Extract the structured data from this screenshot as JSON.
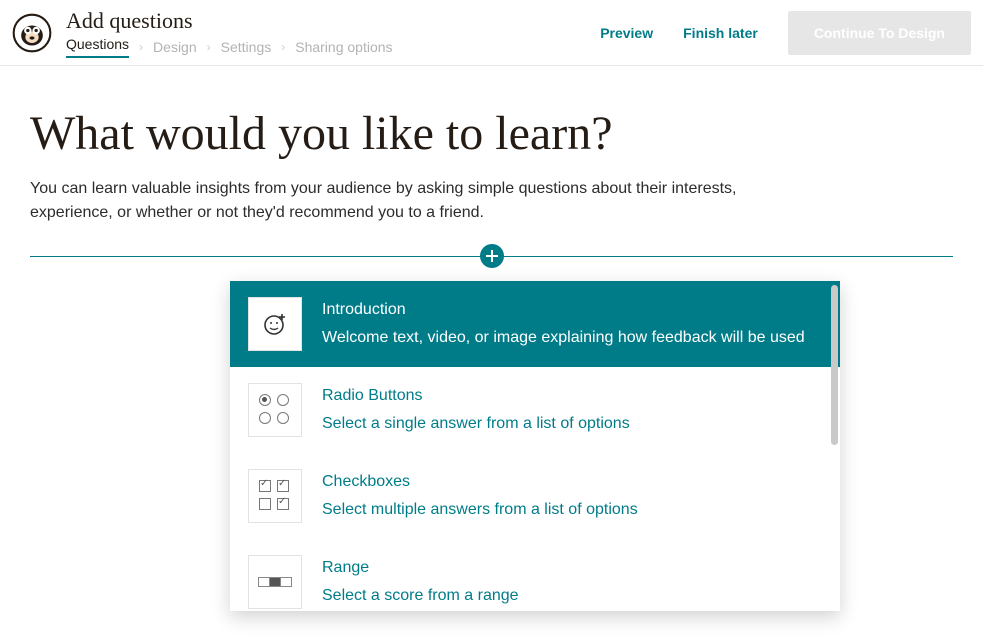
{
  "header": {
    "title": "Add questions",
    "breadcrumb": {
      "questions": "Questions",
      "design": "Design",
      "settings": "Settings",
      "sharing": "Sharing options"
    },
    "preview": "Preview",
    "finish_later": "Finish later",
    "continue": "Continue To Design"
  },
  "main": {
    "heading": "What would you like to learn?",
    "subtext": "You can learn valuable insights from your audience by asking simple questions about their interests, experience, or whether or not they'd recommend you to a friend."
  },
  "dropdown": {
    "items": [
      {
        "title": "Introduction",
        "desc": "Welcome text, video, or image explaining how feedback will be used",
        "selected": true
      },
      {
        "title": "Radio Buttons",
        "desc": "Select a single answer from a list of options",
        "selected": false
      },
      {
        "title": "Checkboxes",
        "desc": "Select multiple answers from a list of options",
        "selected": false
      },
      {
        "title": "Range",
        "desc": "Select a score from a range",
        "selected": false
      }
    ]
  }
}
